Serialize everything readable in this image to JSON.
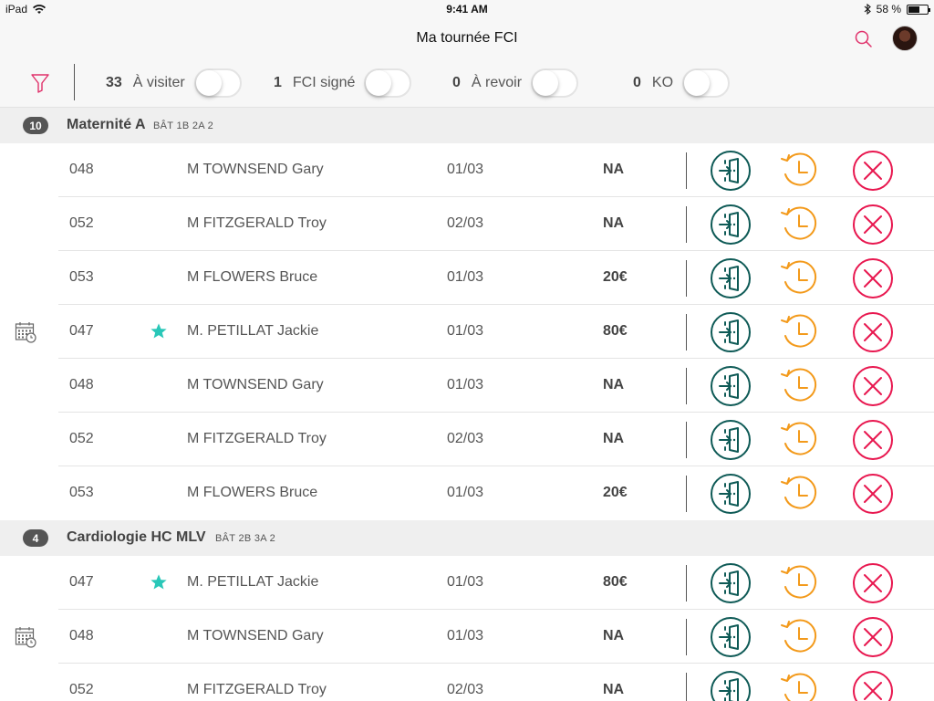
{
  "status_bar": {
    "device": "iPad",
    "time": "9:41 AM",
    "battery": "58 %",
    "battery_level": 0.58
  },
  "nav": {
    "title": "Ma tournée FCI",
    "search_icon": "search-icon",
    "avatar_icon": "avatar"
  },
  "filters": [
    {
      "count": "33",
      "label": "À visiter",
      "on": false
    },
    {
      "count": "1",
      "label": "FCI signé",
      "on": false
    },
    {
      "count": "0",
      "label": "À revoir",
      "on": false
    },
    {
      "count": "0",
      "label": "KO",
      "on": false
    }
  ],
  "sections": [
    {
      "badge": "10",
      "name": "Maternité A",
      "bat": "BÂT  1B 2A 2",
      "calendar_icon": "calendar-history-icon",
      "rows": [
        {
          "num": "048",
          "star": false,
          "name": "M TOWNSEND Gary",
          "date": "01/03",
          "amount": "NA"
        },
        {
          "num": "052",
          "star": false,
          "name": "M FITZGERALD Troy",
          "date": "02/03",
          "amount": "NA"
        },
        {
          "num": "053",
          "star": false,
          "name": "M FLOWERS Bruce",
          "date": "01/03",
          "amount": "20€"
        },
        {
          "num": "047",
          "star": true,
          "name": "M. PETILLAT Jackie",
          "date": "01/03",
          "amount": "80€"
        },
        {
          "num": "048",
          "star": false,
          "name": "M TOWNSEND Gary",
          "date": "01/03",
          "amount": "NA"
        },
        {
          "num": "052",
          "star": false,
          "name": "M FITZGERALD Troy",
          "date": "02/03",
          "amount": "NA"
        },
        {
          "num": "053",
          "star": false,
          "name": "M FLOWERS Bruce",
          "date": "01/03",
          "amount": "20€"
        }
      ]
    },
    {
      "badge": "4",
      "name": "Cardiologie HC MLV",
      "bat": "BÂT  2B 3A 2",
      "calendar_icon": "calendar-history-icon",
      "rows": [
        {
          "num": "047",
          "star": true,
          "name": "M. PETILLAT Jackie",
          "date": "01/03",
          "amount": "80€"
        },
        {
          "num": "048",
          "star": false,
          "name": "M TOWNSEND Gary",
          "date": "01/03",
          "amount": "NA"
        },
        {
          "num": "052",
          "star": false,
          "name": "M FITZGERALD Troy",
          "date": "02/03",
          "amount": "NA"
        }
      ]
    }
  ],
  "actions": {
    "enter_icon": "enter-door-icon",
    "later_icon": "postpone-clock-icon",
    "ko_icon": "close-icon"
  },
  "colors": {
    "enter": "#0e5a56",
    "later": "#f39a1b",
    "ko": "#e8174f",
    "star": "#29c7b8",
    "accent": "#e0306a"
  }
}
